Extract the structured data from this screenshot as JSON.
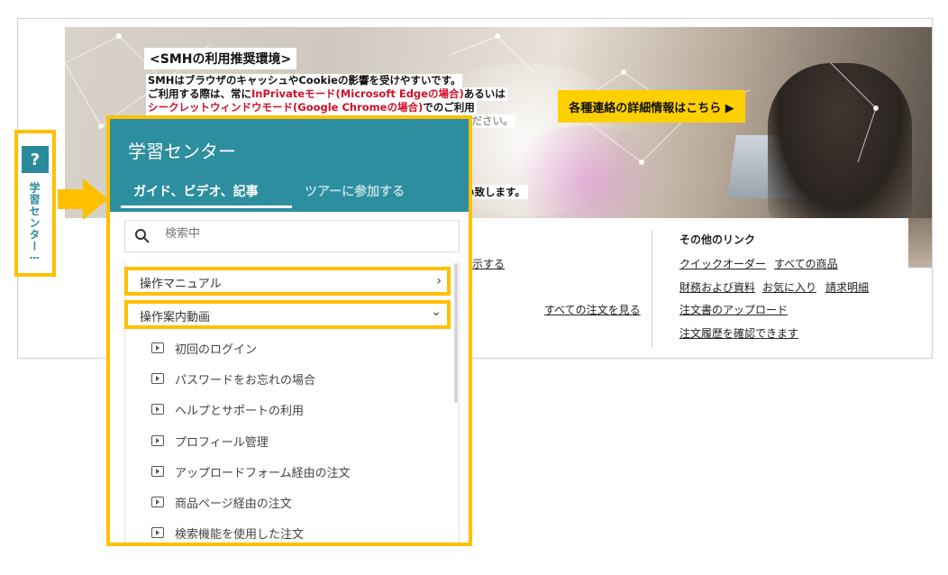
{
  "banner": {
    "title": "<SMHの利用推奨環境>",
    "line1": "SMHはブラウザのキャッシュやCookieの影響を受けやすいです。",
    "line2_a": "ご利用する際は、常に",
    "line2_red": "InPrivateモード(Microsoft Edgeの場合)",
    "line2_b": "あるいは",
    "line3_red": "シークレットウィンドウモード(Google Chromeの場合)",
    "line3_b": "でのご利用",
    "line4_partial": "ください。",
    "tail": "い致します。",
    "cta_label": "各種連絡の詳細情報はこちら ▶"
  },
  "other_links": {
    "heading": "その他のリンク",
    "quick_order": "クイックオーダー",
    "all_products": "すべての商品",
    "finance": "財務および資料",
    "favorites": "お気に入り",
    "invoice": "請求明細",
    "po_upload": "注文書のアップロード",
    "history": "注文履歴を確認できます"
  },
  "orders": {
    "all_orders": "すべての注文を見る",
    "show_partial": "示する"
  },
  "learning_tab": {
    "icon_text": "?",
    "label": "学習センター⋮"
  },
  "panel": {
    "title": "学習センター",
    "tabs": [
      {
        "label": "ガイド、ビデオ、記事"
      },
      {
        "label": "ツアーに参加する"
      }
    ],
    "search_placeholder": "検索中",
    "sections": [
      {
        "label": "操作マニュアル",
        "chevron": "›"
      },
      {
        "label": "操作案内動画",
        "chevron": "⌄"
      }
    ],
    "videos": [
      "初回のログイン",
      "パスワードをお忘れの場合",
      "ヘルプとサポートの利用",
      "プロフィール管理",
      "アップロードフォーム経由の注文",
      "商品ページ経由の注文",
      "検索機能を使用した注文"
    ]
  },
  "colors": {
    "accent_teal": "#2d8ea0",
    "highlight_yellow": "#ffc000",
    "cta_yellow": "#ffd000",
    "warning_red": "#d0102a"
  }
}
